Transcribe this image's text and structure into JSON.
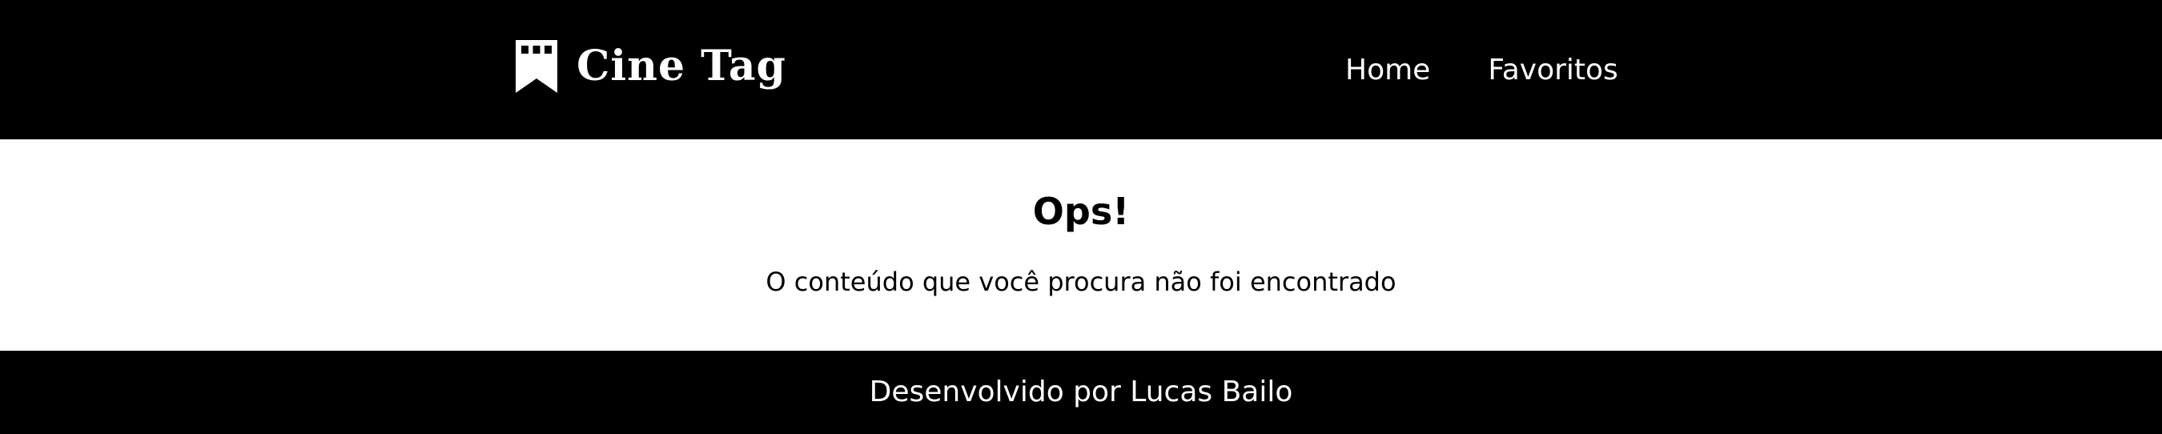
{
  "header": {
    "logo_text": "Cine Tag",
    "logo_icon": "bookmark-film-icon",
    "nav": [
      {
        "label": "Home"
      },
      {
        "label": "Favoritos"
      }
    ]
  },
  "main": {
    "title": "Ops!",
    "message": "O conteúdo que você procura não foi encontrado"
  },
  "footer": {
    "text": "Desenvolvido por Lucas Bailo"
  },
  "colors": {
    "header_bg": "#000000",
    "footer_bg": "#000000",
    "main_bg": "#ffffff",
    "text_light": "#ffffff",
    "text_dark": "#000000"
  }
}
